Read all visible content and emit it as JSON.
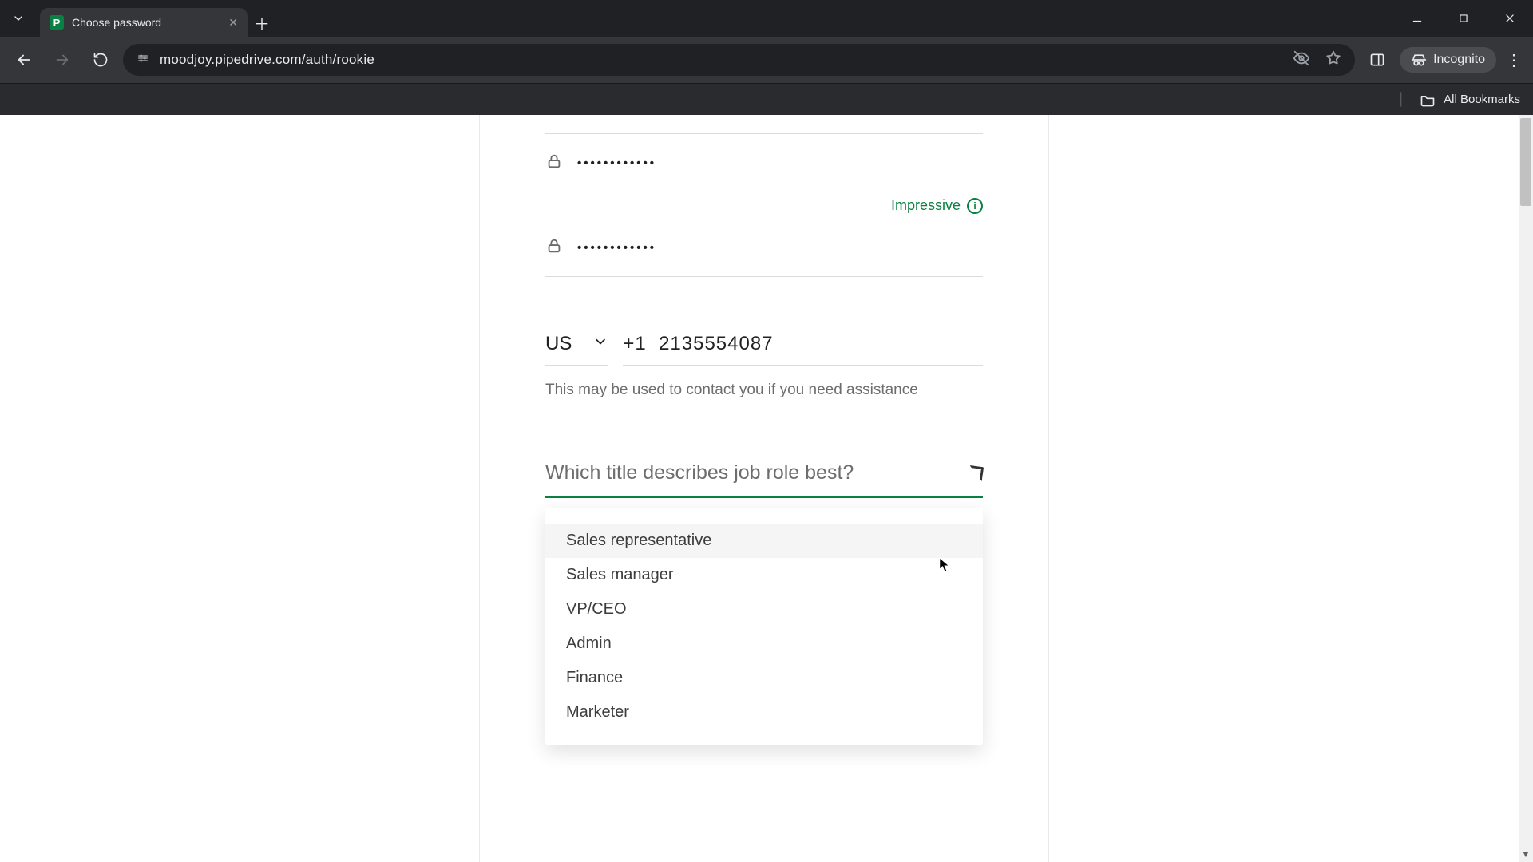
{
  "browser": {
    "tab_title": "Choose password",
    "favicon_letter": "P",
    "url": "moodjoy.pipedrive.com/auth/rookie",
    "incognito_label": "Incognito",
    "all_bookmarks_label": "All Bookmarks"
  },
  "form": {
    "password_masked": "••••••••••••",
    "password_confirm_masked": "••••••••••••",
    "password_strength_label": "Impressive",
    "phone": {
      "country_code": "US",
      "dial_prefix": "+1",
      "number": "2135554087",
      "help_text": "This may be used to contact you if you need assistance"
    },
    "role": {
      "placeholder": "Which title describes job role best?",
      "options": [
        "Sales representative",
        "Sales manager",
        "VP/CEO",
        "Admin",
        "Finance",
        "Marketer"
      ]
    }
  },
  "colors": {
    "accent": "#0b8043"
  }
}
